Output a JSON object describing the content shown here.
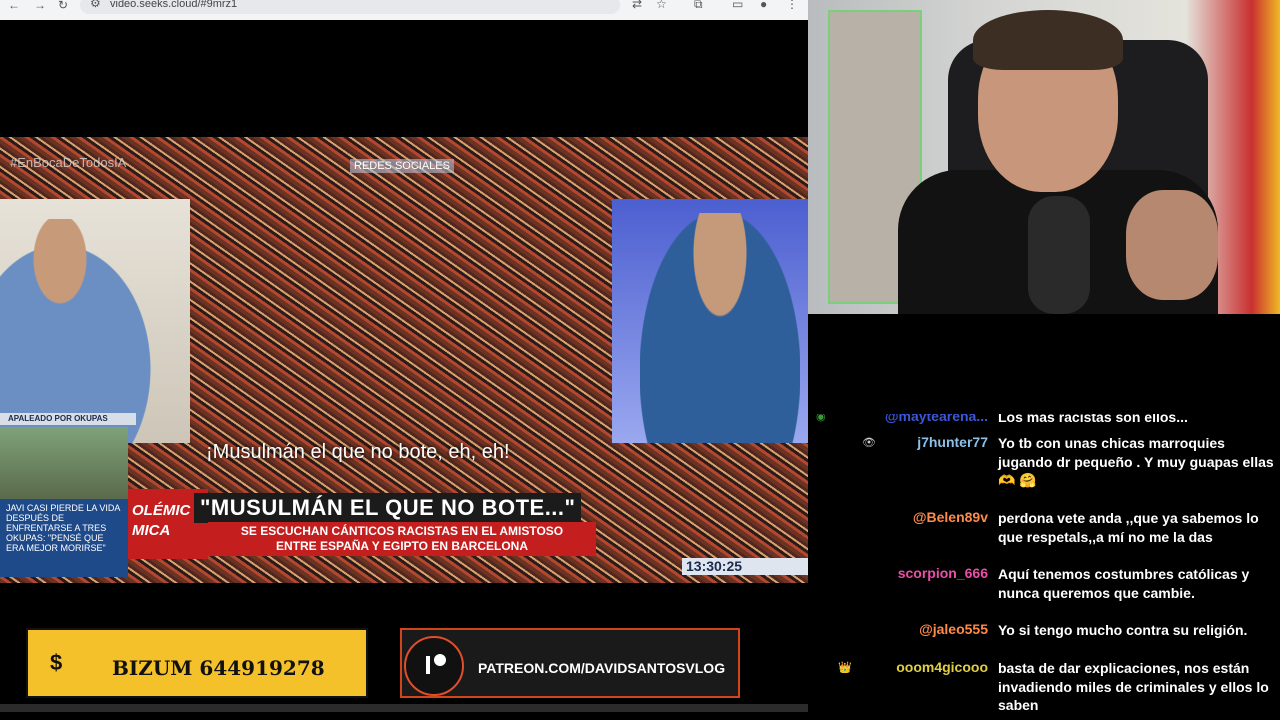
{
  "browser": {
    "url": "video.seeks.cloud/#9mrz1"
  },
  "video": {
    "hashtag": "#EnBocaDeTodosIA",
    "redes_label": "REDES SOCIALES",
    "caption_okupas": "APALEADO POR OKUPAS",
    "okupa_story": "JAVI CASI PIERDE LA VIDA DESPUÉS DE ENFRENTARSE A TRES OKUPAS: \"PENSÉ QUE ERA MEJOR MORIRSE\"",
    "subtitle": "¡Musulmán el que no bote, eh, eh!",
    "headline": "\"MUSULMÁN EL QUE NO BOTE...\"",
    "subhead_line1": "SE ESCUCHAN CÁNTICOS RACISTAS EN EL AMISTOSO",
    "subhead_line2": "ENTRE ESPAÑA Y EGIPTO EN BARCELONA",
    "polemic_line1": "OLÉMIC",
    "polemic_line2": "MICA",
    "clock": "13:30:25"
  },
  "banners": {
    "bizum_icon": "$",
    "bizum_text": "BIZUM 644919278",
    "patreon_text": "PATREON.COM/DAVIDSANTOSVLOG"
  },
  "chat": {
    "messages": [
      {
        "user": "@maytearena...",
        "color": "#3b56d6",
        "text": "Los más racistas son ellos..."
      },
      {
        "user": "j7hunter77",
        "color": "#8cc0e8",
        "badge": "👁",
        "text": "Yo tb con unas chicas marroquies jugando dr pequeño . Y muy guapas ellas 🫶 🤗"
      },
      {
        "user": "@Belen89v",
        "color": "#ff8a4a",
        "text": "perdona vete anda ,,que ya sabemos lo que respetals,,a mí no me la das"
      },
      {
        "user": "scorpion_666",
        "color": "#e94fa8",
        "text": "Aquí tenemos costumbres católicas y nunca queremos que cambie."
      },
      {
        "user": "@jaleo555",
        "color": "#ff8a4a",
        "text": "Yo si tengo mucho contra su religión."
      },
      {
        "user": "ooom4gicooo",
        "color": "#e0d040",
        "badge": "👑",
        "text": "basta de dar explicaciones, nos están invadiendo miles de criminales y ellos lo saben"
      }
    ]
  }
}
